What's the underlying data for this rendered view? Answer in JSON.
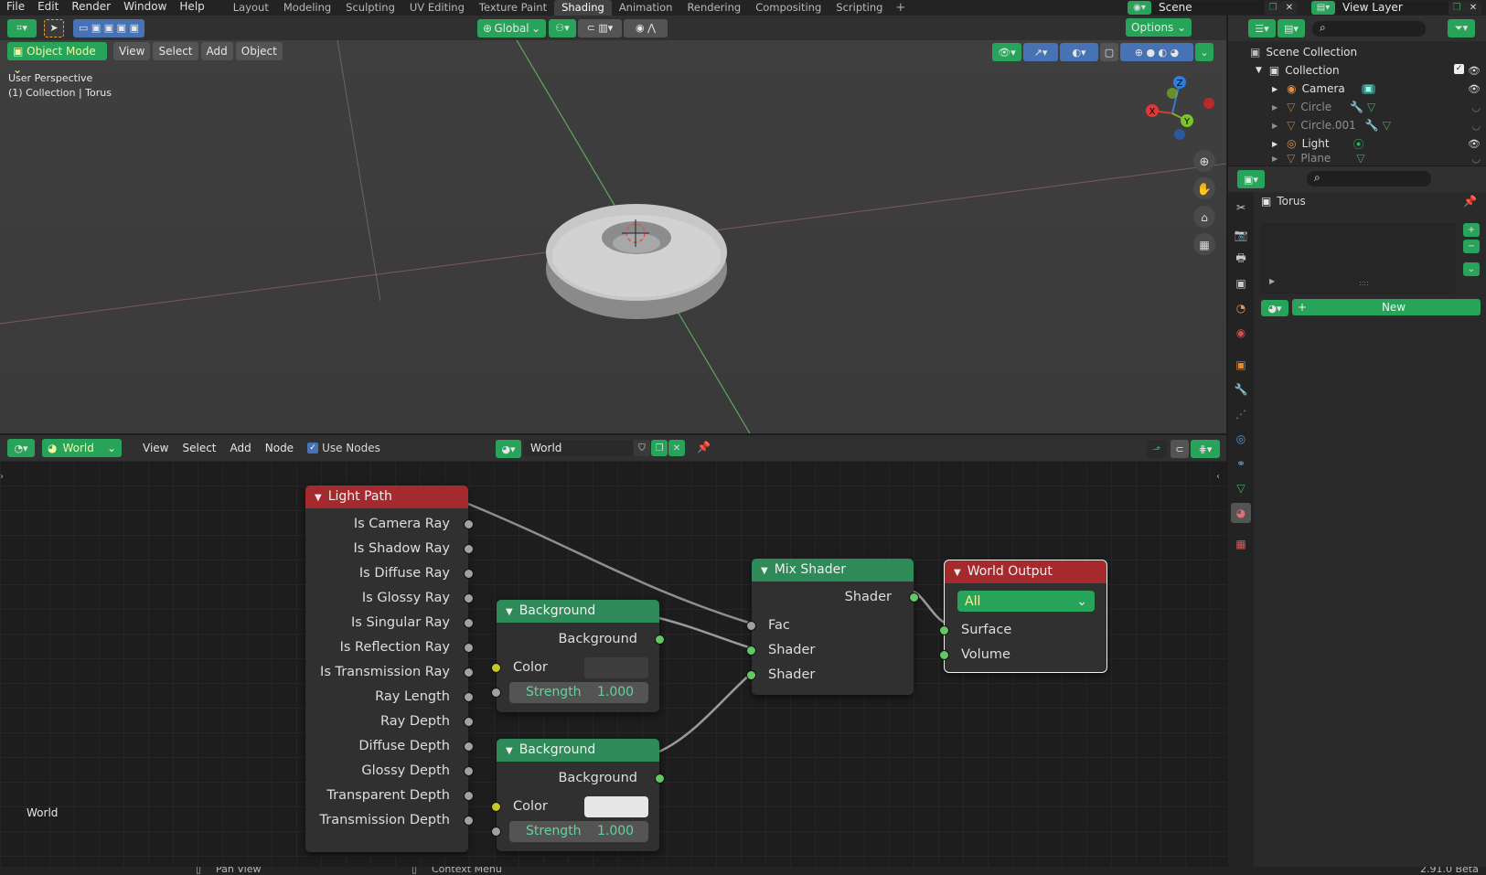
{
  "topbar": {
    "menus": [
      "File",
      "Edit",
      "Render",
      "Window",
      "Help"
    ],
    "workspaces": [
      "Layout",
      "Modeling",
      "Sculpting",
      "UV Editing",
      "Texture Paint",
      "Shading",
      "Animation",
      "Rendering",
      "Compositing",
      "Scripting"
    ],
    "active_workspace": "Shading",
    "add_workspace": "+",
    "scene_name": "Scene",
    "view_layer_name": "View Layer"
  },
  "viewport": {
    "mode": "Object Mode",
    "menus": [
      "View",
      "Select",
      "Add",
      "Object"
    ],
    "transform_orientation": "Global",
    "options_label": "Options",
    "overlay_line1": "User Perspective",
    "overlay_line2": "(1) Collection | Torus",
    "gizmo_axes": {
      "x": "X",
      "y": "Y",
      "z": "Z"
    }
  },
  "outliner": {
    "root": "Scene Collection",
    "collection": "Collection",
    "items": [
      {
        "label": "Camera",
        "dim": false
      },
      {
        "label": "Circle",
        "dim": true
      },
      {
        "label": "Circle.001",
        "dim": true
      },
      {
        "label": "Light",
        "dim": false
      },
      {
        "label": "Plane",
        "dim": true
      }
    ]
  },
  "properties": {
    "object_name": "Torus",
    "new_label": "New",
    "plus": "+",
    "minus": "−"
  },
  "node_editor": {
    "shader_type": "World",
    "menus": [
      "View",
      "Select",
      "Add",
      "Node"
    ],
    "use_nodes_label": "Use Nodes",
    "world_name": "World",
    "canvas_label": "World",
    "nodes": {
      "light_path": {
        "title": "Light Path",
        "outputs": [
          "Is Camera Ray",
          "Is Shadow Ray",
          "Is Diffuse Ray",
          "Is Glossy Ray",
          "Is Singular Ray",
          "Is Reflection Ray",
          "Is Transmission Ray",
          "Ray Length",
          "Ray Depth",
          "Diffuse Depth",
          "Glossy Depth",
          "Transparent Depth",
          "Transmission Depth"
        ]
      },
      "background1": {
        "title": "Background",
        "output": "Background",
        "color_label": "Color",
        "strength_label": "Strength",
        "strength_value": "1.000",
        "color_hex": "#3e3e3e"
      },
      "background2": {
        "title": "Background",
        "output": "Background",
        "color_label": "Color",
        "strength_label": "Strength",
        "strength_value": "1.000",
        "color_hex": "#e6e6e6"
      },
      "mix_shader": {
        "title": "Mix Shader",
        "output": "Shader",
        "inputs": [
          "Fac",
          "Shader",
          "Shader"
        ]
      },
      "world_output": {
        "title": "World Output",
        "target": "All",
        "inputs": [
          "Surface",
          "Volume"
        ]
      }
    }
  },
  "statusbar": {
    "left": "Pan View",
    "middle": "Context Menu",
    "version": "2.91.0 Beta"
  },
  "colors": {
    "accent_green": "#28a45a",
    "node_red": "#a52a2e",
    "node_green": "#2e8a58",
    "annotation_red": "#e0141e"
  }
}
